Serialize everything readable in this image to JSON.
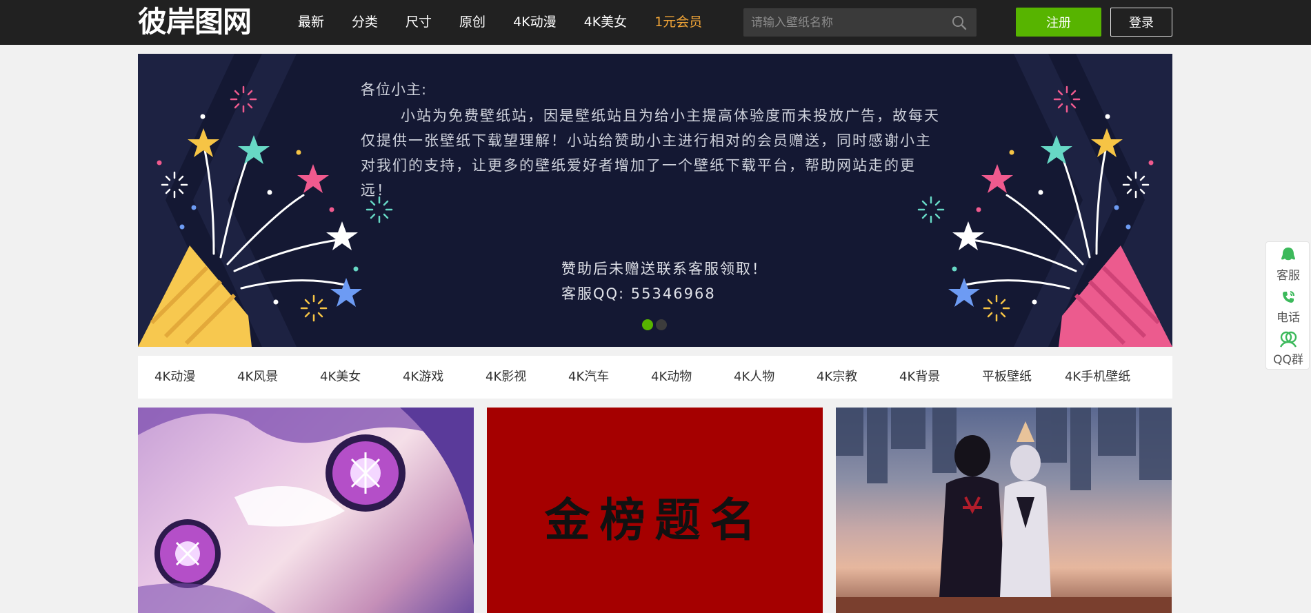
{
  "header": {
    "logo": "彼岸图网",
    "nav": [
      "最新",
      "分类",
      "尺寸",
      "原创",
      "4K动漫",
      "4K美女",
      "1元会员"
    ],
    "search_placeholder": "请输入壁纸名称",
    "register": "注册",
    "login": "登录"
  },
  "banner": {
    "greeting": "各位小主:",
    "paragraph": "小站为免费壁纸站，因是壁纸站且为给小主提高体验度而未投放广告，故每天仅提供一张壁纸下载望理解！小站给赞助小主进行相对的会员赠送，同时感谢小主对我们的支持，让更多的壁纸爱好者增加了一个壁纸下载平台，帮助网站走的更远！",
    "sponsor": "赞助后未赠送联系客服领取！",
    "qq": "客服QQ: 55346968"
  },
  "categories": [
    "4K动漫",
    "4K风景",
    "4K美女",
    "4K游戏",
    "4K影视",
    "4K汽车",
    "4K动物",
    "4K人物",
    "4K宗教",
    "4K背景",
    "平板壁纸",
    "4K手机壁纸"
  ],
  "thumbnails": {
    "center_text": "金榜题名"
  },
  "side": {
    "service": "客服",
    "phone": "电话",
    "qq_group": "QQ群"
  },
  "colors": {
    "header_bg": "#212121",
    "accent_green": "#57b400",
    "vip_orange": "#f0a437",
    "banner_bg": "#141833"
  }
}
